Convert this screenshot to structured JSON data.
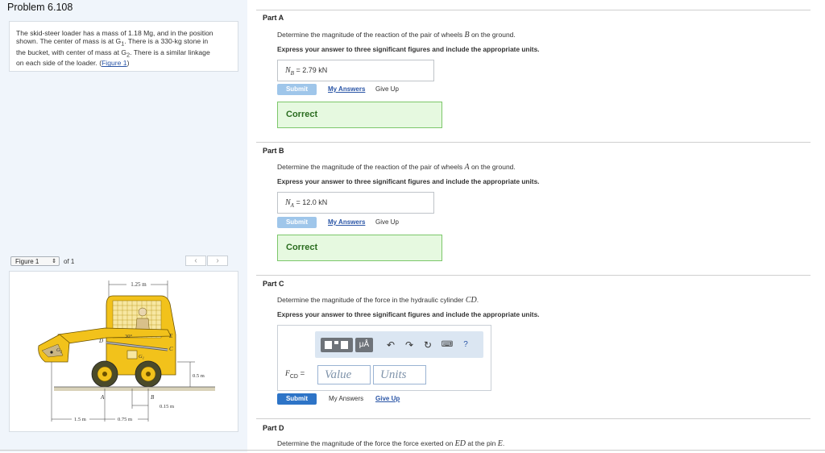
{
  "problem": {
    "title": "Problem 6.108",
    "text_1": "The skid-steer loader has a mass of 1.18 Mg, and in the position",
    "text_2": "shown. The center of mass is at G",
    "text_2b": "1",
    "text_2c": ". There is a 330-kg stone in",
    "text_3": "the bucket, with center of mass at G",
    "text_3b": "2",
    "text_3c": ". There is a similar linkage",
    "text_4": "on each side of the loader. (",
    "figure_link": "Figure 1",
    "text_4b": ")"
  },
  "figure": {
    "selector_value": "Figure 1",
    "of_text": "of 1",
    "prev_icon": "‹",
    "next_icon": "›",
    "labels": {
      "dim_top": "1.25 m",
      "angle": "30°",
      "E": "E",
      "C": "C",
      "D": "D",
      "G1": "G",
      "G1_sub": "1",
      "G2": "G",
      "G2_sub": "2",
      "A": "A",
      "B": "B",
      "dim_h": "0.5 m",
      "dim_015": "0.15 m",
      "dim_15": "1.5 m",
      "dim_075": "0.75 m"
    }
  },
  "parts": {
    "a": {
      "label": "Part A",
      "question_pre": "Determine the magnitude of the reaction of the pair of wheels ",
      "question_var": "B",
      "question_post": " on the ground.",
      "instruction": "Express your answer to three significant figures and include the appropriate units.",
      "answer_var": "N",
      "answer_sub": "B",
      "answer_eq": " = ",
      "answer_value": "2.79 kN",
      "submit": "Submit",
      "my_answers": "My Answers",
      "give_up": "Give Up",
      "feedback": "Correct"
    },
    "b": {
      "label": "Part B",
      "question_pre": "Determine the magnitude of the reaction of the pair of wheels ",
      "question_var": "A",
      "question_post": " on the ground.",
      "instruction": "Express your answer to three significant figures and include the appropriate units.",
      "answer_var": "N",
      "answer_sub": "A",
      "answer_eq": " = ",
      "answer_value": "12.0 kN",
      "submit": "Submit",
      "my_answers": "My Answers",
      "give_up": "Give Up",
      "feedback": "Correct"
    },
    "c": {
      "label": "Part C",
      "question_pre": "Determine the magnitude of the force in the hydraulic cylinder ",
      "question_var": "CD",
      "question_post": ".",
      "instruction": "Express your answer to three significant figures and include the appropriate units.",
      "field_var": "F",
      "field_sub": "CD",
      "field_eq": " = ",
      "value_placeholder": "Value",
      "units_placeholder": "Units",
      "toolbar_mu": "μÅ",
      "toolbar_help": "?",
      "submit": "Submit",
      "my_answers": "My Answers",
      "give_up": "Give Up"
    },
    "d": {
      "label": "Part D",
      "question_pre": "Determine the magnitude of the force the force exerted on ",
      "question_var": "ED",
      "question_mid": " at the pin ",
      "question_var2": "E",
      "question_post": "."
    }
  },
  "colors": {
    "submit_active": "#2d74c7",
    "submit_disabled": "#9fc6ea",
    "correct_bg": "#e6f9e0",
    "correct_border": "#7cc76a",
    "link": "#2a55a6",
    "loader_yellow": "#f2c21b"
  }
}
